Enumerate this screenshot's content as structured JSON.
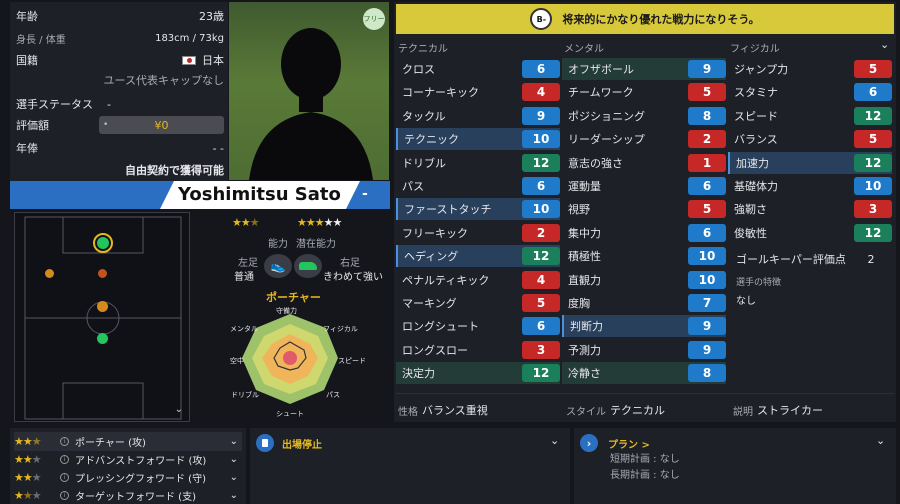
{
  "profile": {
    "age_label": "年齢",
    "age_value": "23歳",
    "height_label": "身長 / 体重",
    "height_value": "183cm / 73kg",
    "nation_label": "国籍",
    "nation_value": "日本",
    "nation_note": "ユース代表キャップなし",
    "status_label": "選手ステータス",
    "status_value": "-",
    "value_label": "評価額",
    "value_amount": "¥0",
    "wage_label": "年俸",
    "wage_value": "- -",
    "transfer_note": "自由契約で獲得可能",
    "free_tag": "フリー",
    "name": "Yoshimitsu Sato",
    "name_badge": "-"
  },
  "ratings": {
    "ability_label": "能力",
    "potential_label": "潜在能力",
    "ability_stars": 2.5,
    "potential_stars": 3,
    "left_foot_label": "左足",
    "left_foot_value": "普通",
    "right_foot_label": "右足",
    "right_foot_value": "きわめて強い",
    "role_title": "ポーチャー"
  },
  "radar": {
    "labels": [
      "守備力",
      "フィジカル",
      "スピード",
      "パス",
      "シュート",
      "ドリブル",
      "空中",
      "メンタル"
    ]
  },
  "header": {
    "grade": "B-",
    "summary": "将来的にかなり優れた戦力になりそう。"
  },
  "technical": {
    "title": "テクニカル",
    "items": [
      {
        "label": "クロス",
        "value": "6",
        "color": "blue",
        "hl": ""
      },
      {
        "label": "コーナーキック",
        "value": "4",
        "color": "red",
        "hl": ""
      },
      {
        "label": "タックル",
        "value": "9",
        "color": "blue",
        "hl": ""
      },
      {
        "label": "テクニック",
        "value": "10",
        "color": "blue",
        "hl": "hl"
      },
      {
        "label": "ドリブル",
        "value": "12",
        "color": "green",
        "hl": ""
      },
      {
        "label": "パス",
        "value": "6",
        "color": "blue",
        "hl": ""
      },
      {
        "label": "ファーストタッチ",
        "value": "10",
        "color": "blue",
        "hl": "hl"
      },
      {
        "label": "フリーキック",
        "value": "2",
        "color": "red",
        "hl": ""
      },
      {
        "label": "ヘディング",
        "value": "12",
        "color": "green",
        "hl": "hl"
      },
      {
        "label": "ペナルティキック",
        "value": "4",
        "color": "red",
        "hl": ""
      },
      {
        "label": "マーキング",
        "value": "5",
        "color": "red",
        "hl": ""
      },
      {
        "label": "ロングシュート",
        "value": "6",
        "color": "blue",
        "hl": ""
      },
      {
        "label": "ロングスロー",
        "value": "3",
        "color": "red",
        "hl": ""
      },
      {
        "label": "決定力",
        "value": "12",
        "color": "green",
        "hl": "hl2"
      }
    ]
  },
  "mental": {
    "title": "メンタル",
    "items": [
      {
        "label": "オフザボール",
        "value": "9",
        "color": "blue",
        "hl": "hl2"
      },
      {
        "label": "チームワーク",
        "value": "5",
        "color": "red",
        "hl": ""
      },
      {
        "label": "ポジショニング",
        "value": "8",
        "color": "blue",
        "hl": ""
      },
      {
        "label": "リーダーシップ",
        "value": "2",
        "color": "red",
        "hl": ""
      },
      {
        "label": "意志の強さ",
        "value": "1",
        "color": "red",
        "hl": ""
      },
      {
        "label": "運動量",
        "value": "6",
        "color": "blue",
        "hl": ""
      },
      {
        "label": "視野",
        "value": "5",
        "color": "red",
        "hl": ""
      },
      {
        "label": "集中力",
        "value": "6",
        "color": "blue",
        "hl": ""
      },
      {
        "label": "積極性",
        "value": "10",
        "color": "blue",
        "hl": ""
      },
      {
        "label": "直観力",
        "value": "10",
        "color": "blue",
        "hl": ""
      },
      {
        "label": "度胸",
        "value": "7",
        "color": "blue",
        "hl": ""
      },
      {
        "label": "判断力",
        "value": "9",
        "color": "blue",
        "hl": "hl"
      },
      {
        "label": "予測力",
        "value": "9",
        "color": "blue",
        "hl": ""
      },
      {
        "label": "冷静さ",
        "value": "8",
        "color": "blue",
        "hl": "hl2"
      }
    ]
  },
  "physical": {
    "title": "フィジカル",
    "items": [
      {
        "label": "ジャンプ力",
        "value": "5",
        "color": "red",
        "hl": ""
      },
      {
        "label": "スタミナ",
        "value": "6",
        "color": "blue",
        "hl": ""
      },
      {
        "label": "スピード",
        "value": "12",
        "color": "green",
        "hl": ""
      },
      {
        "label": "バランス",
        "value": "5",
        "color": "red",
        "hl": ""
      },
      {
        "label": "加速力",
        "value": "12",
        "color": "green",
        "hl": "hl"
      },
      {
        "label": "基礎体力",
        "value": "10",
        "color": "blue",
        "hl": ""
      },
      {
        "label": "強靭さ",
        "value": "3",
        "color": "red",
        "hl": ""
      },
      {
        "label": "俊敏性",
        "value": "12",
        "color": "green",
        "hl": ""
      }
    ],
    "gk_label": "ゴールキーパー評価点",
    "gk_value": "2",
    "traits_label": "選手の特徴",
    "traits_value": "なし"
  },
  "footer": {
    "personality_label": "性格",
    "personality_value": "バランス重視",
    "style_label": "スタイル",
    "style_value": "テクニカル",
    "desc_label": "説明",
    "desc_value": "ストライカー"
  },
  "roles": [
    {
      "name": "ポーチャー (攻)",
      "stars": 2.5
    },
    {
      "name": "アドバンストフォワード (攻)",
      "stars": 2
    },
    {
      "name": "プレッシングフォワード (守)",
      "stars": 2
    },
    {
      "name": "ターゲットフォワード (支)",
      "stars": 1.5
    }
  ],
  "injury": {
    "title": "出場停止"
  },
  "plan": {
    "title": "プラン >",
    "short_label": "短期計画 : なし",
    "long_label": "長期計画 : なし"
  },
  "colors": {
    "accent": "#e5b820",
    "name_bar": "#2a6fc2",
    "header_bar": "#d8c93a"
  }
}
